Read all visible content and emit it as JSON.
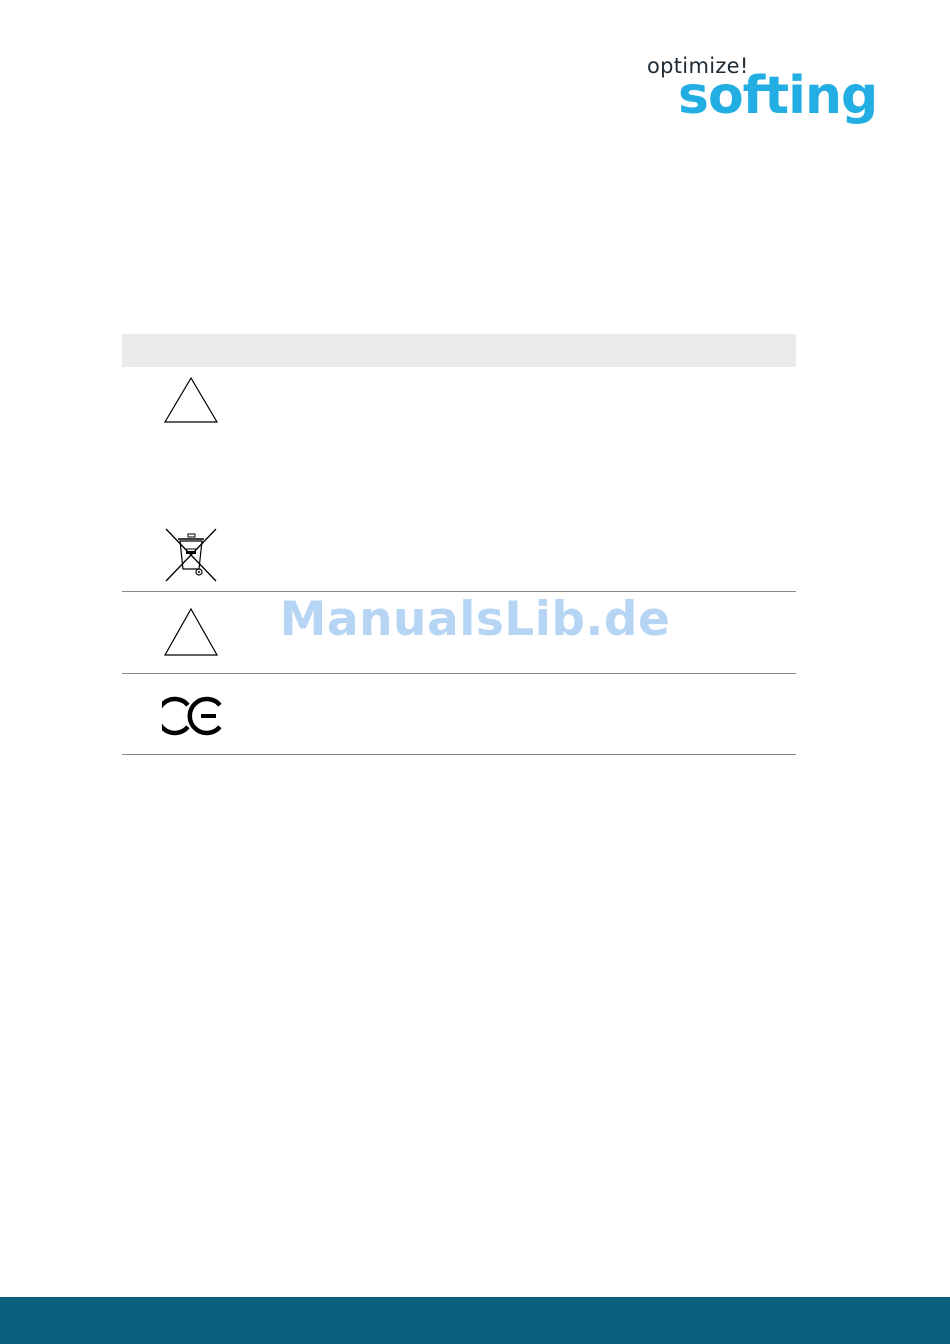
{
  "logo": {
    "tagline": "optimize!",
    "wordmark": "softing",
    "color": "#22aee3"
  },
  "table": {
    "header_color": "#ebebeb",
    "rows": [
      {
        "icons": [
          "warning-triangle-icon",
          "weee-crossed-bin-icon"
        ]
      },
      {
        "icons": [
          "warning-triangle-icon"
        ]
      },
      {
        "icons": [
          "ce-mark-icon"
        ]
      }
    ]
  },
  "watermark": {
    "text": "ManualsLib.de"
  },
  "footer": {
    "color": "#0b617d"
  }
}
